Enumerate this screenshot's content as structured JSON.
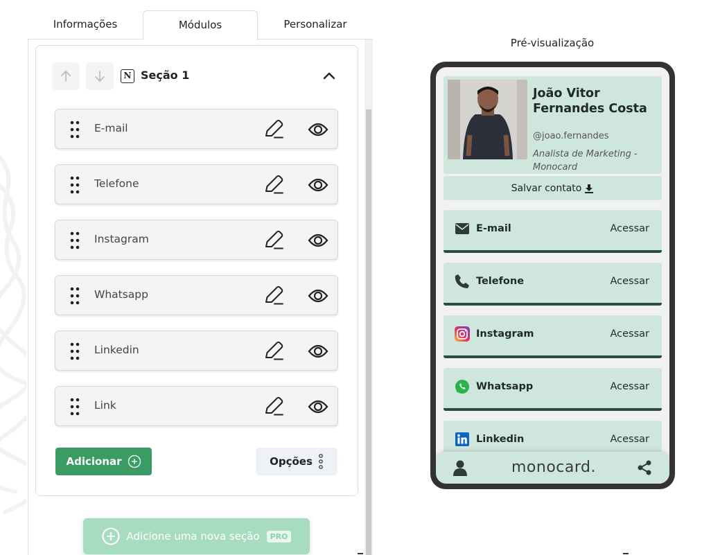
{
  "tabs": [
    {
      "label": "Informações"
    },
    {
      "label": "Módulos"
    },
    {
      "label": "Personalizar"
    }
  ],
  "section": {
    "title": "Seção 1",
    "modules": [
      {
        "label": "E-mail"
      },
      {
        "label": "Telefone"
      },
      {
        "label": "Instagram"
      },
      {
        "label": "Whatsapp"
      },
      {
        "label": "Linkedin"
      },
      {
        "label": "Link"
      }
    ],
    "add_label": "Adicionar",
    "options_label": "Opções"
  },
  "new_section": {
    "label": "Adicione uma nova seção",
    "badge": "PRO"
  },
  "preview": {
    "title": "Pré-visualização",
    "profile": {
      "name": "João Vitor Fernandes Costa",
      "handle": "@joao.fernandes",
      "role": "Analista de Marketing - Monocard"
    },
    "save_contact": "Salvar contato",
    "links": [
      {
        "label": "E-mail",
        "action": "Acessar",
        "icon": "mail-icon"
      },
      {
        "label": "Telefone",
        "action": "Acessar",
        "icon": "phone-icon"
      },
      {
        "label": "Instagram",
        "action": "Acessar",
        "icon": "instagram-icon"
      },
      {
        "label": "Whatsapp",
        "action": "Acessar",
        "icon": "whatsapp-icon"
      },
      {
        "label": "Linkedin",
        "action": "Acessar",
        "icon": "linkedin-icon"
      }
    ],
    "logo": "monocard."
  },
  "colors": {
    "primary_green": "#3a9b64",
    "card_mint": "#cfe6dd",
    "card_border": "#2a4c44",
    "phone_frame": "#333333"
  }
}
